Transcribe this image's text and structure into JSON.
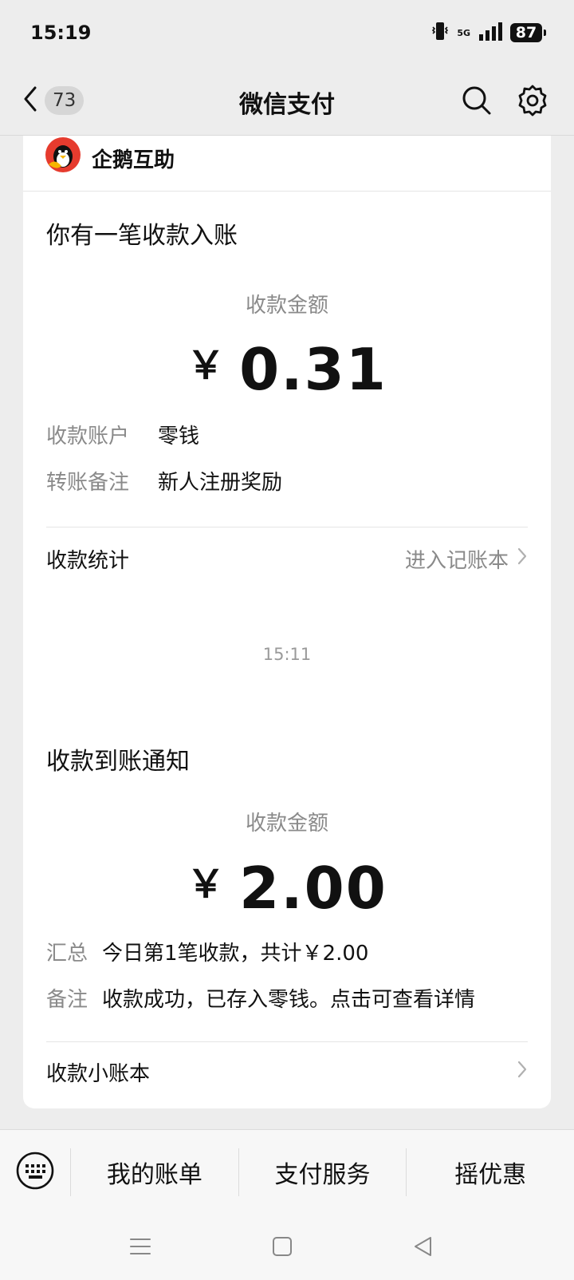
{
  "status": {
    "time": "15:19",
    "network": "5G",
    "battery": "87"
  },
  "nav": {
    "unread_count": "73",
    "title": "微信支付"
  },
  "card1": {
    "sender": "企鹅互助",
    "title": "你有一笔收款入账",
    "amount_label": "收款金额",
    "currency": "￥",
    "amount": "0.31",
    "rows": [
      {
        "label": "收款账户",
        "value": "零钱"
      },
      {
        "label": "转账备注",
        "value": "新人注册奖励"
      }
    ],
    "footer_label": "收款统计",
    "footer_link": "进入记账本"
  },
  "timestamp": "15:11",
  "card2": {
    "title": "收款到账通知",
    "amount_label": "收款金额",
    "currency": "￥",
    "amount": "2.00",
    "rows": [
      {
        "label": "汇总",
        "value": "今日第1笔收款，共计￥2.00"
      },
      {
        "label": "备注",
        "value": "收款成功，已存入零钱。点击可查看详情"
      }
    ],
    "footer_label": "收款小账本"
  },
  "menu": {
    "items": [
      "我的账单",
      "支付服务",
      "摇优惠"
    ]
  }
}
